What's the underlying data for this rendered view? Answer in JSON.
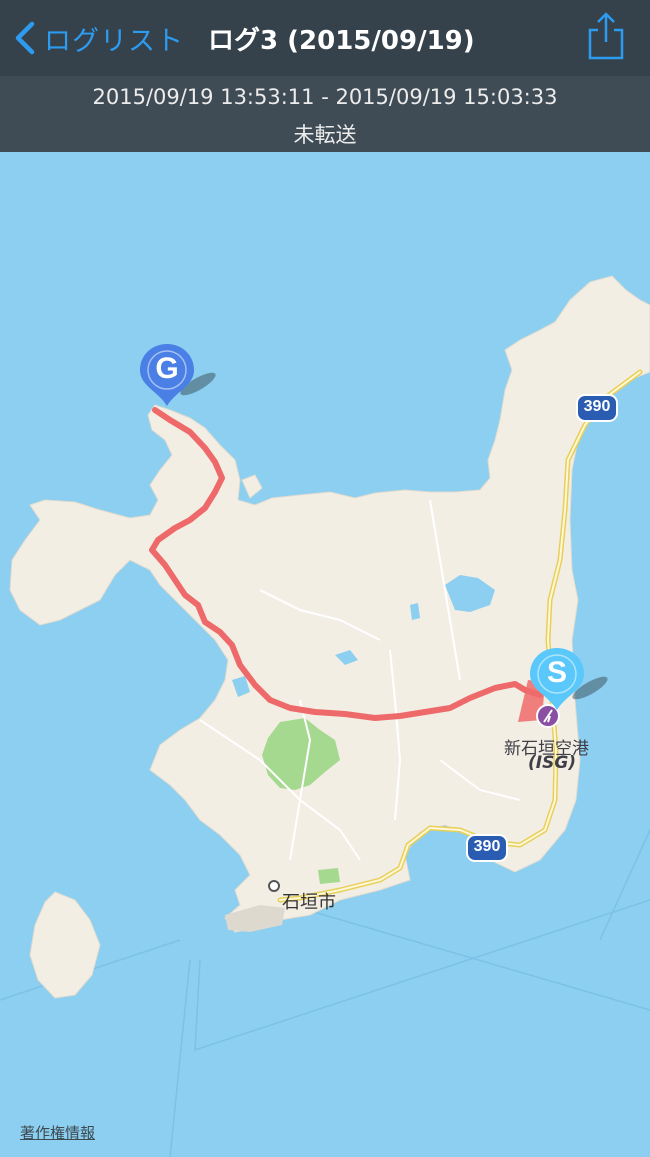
{
  "navbar": {
    "back_label": "ログリスト",
    "title": "ログ3 (2015/09/19)",
    "share_icon": "share-icon"
  },
  "log": {
    "time_range": "2015/09/19 13:53:11 - 2015/09/19 15:03:33",
    "status": "未転送"
  },
  "map": {
    "start_marker": "S",
    "goal_marker": "G",
    "route_color": "#ee6a6a",
    "road_shields": [
      "390",
      "390"
    ],
    "city_label": "石垣市",
    "airport_name": "新石垣空港",
    "airport_code": "(ISG)",
    "credit": "著作権情報"
  },
  "colors": {
    "accent": "#2d9bf0",
    "sea": "#8ccff0",
    "land": "#f3eee4",
    "park": "#a5d98f",
    "start_marker": "#5ac8fa",
    "goal_marker": "#4a7fe6"
  }
}
